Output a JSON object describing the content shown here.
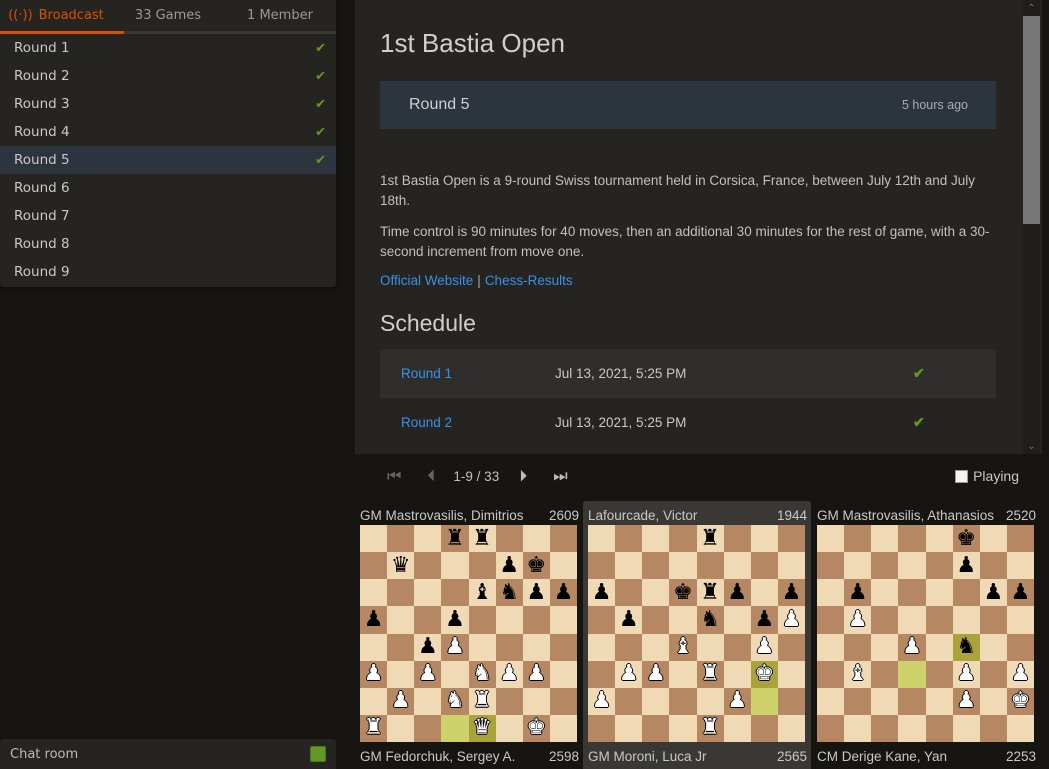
{
  "sidebar": {
    "tabs": [
      {
        "label": "Broadcast",
        "icon": "broadcast-icon",
        "active": true
      },
      {
        "label": "33 Games",
        "active": false
      },
      {
        "label": "1 Member",
        "active": false
      }
    ],
    "rounds": [
      {
        "label": "Round 1",
        "finished": true,
        "active": false
      },
      {
        "label": "Round 2",
        "finished": true,
        "active": false
      },
      {
        "label": "Round 3",
        "finished": true,
        "active": false
      },
      {
        "label": "Round 4",
        "finished": true,
        "active": false
      },
      {
        "label": "Round 5",
        "finished": true,
        "active": true
      },
      {
        "label": "Round 6",
        "finished": false,
        "active": false
      },
      {
        "label": "Round 7",
        "finished": false,
        "active": false
      },
      {
        "label": "Round 8",
        "finished": false,
        "active": false
      },
      {
        "label": "Round 9",
        "finished": false,
        "active": false
      }
    ],
    "check_glyph": "✔"
  },
  "chat": {
    "label": "Chat room",
    "enabled": true
  },
  "main": {
    "title": "1st Bastia Open",
    "current_round": {
      "name": "Round 5",
      "ago": "5 hours ago"
    },
    "description": [
      "1st Bastia Open is a 9-round Swiss tournament held in Corsica, France, between July 12th and July 18th.",
      "Time control is 90 minutes for 40 moves, then an additional 30 minutes for the rest of game, with a 30-second increment from move one."
    ],
    "links": [
      {
        "label": "Official Website"
      },
      {
        "label": "Chess-Results"
      }
    ],
    "link_separator": "|",
    "schedule_title": "Schedule",
    "schedule": [
      {
        "round": "Round 1",
        "date": "Jul 13, 2021, 5:25 PM",
        "finished": true
      },
      {
        "round": "Round 2",
        "date": "Jul 13, 2021, 5:25 PM",
        "finished": true
      }
    ]
  },
  "scrollbar": {
    "up": "⌃",
    "down": "⌄"
  },
  "pager": {
    "first": "⏮",
    "prev": "⏴",
    "info": "1-9 / 33",
    "next": "⏵",
    "last": "⏭",
    "playing_label": "Playing",
    "playing_checked": false
  },
  "games": [
    {
      "top": {
        "name": "GM Mastrovasilis, Dimitrios",
        "rating": "2609"
      },
      "bottom": {
        "name": "GM Fedorchuk, Sergey A.",
        "rating": "2598"
      },
      "highlighted": false,
      "fen": "3rr3/1q3pk1/4bnpp/p2p4/2pP4/P1P1NPP1/1P1NR3/R3Q1K1",
      "last_move": [
        "d1",
        "e1"
      ]
    },
    {
      "top": {
        "name": "Lafourcade, Victor",
        "rating": "1944"
      },
      "bottom": {
        "name": "GM Moroni, Luca Jr",
        "rating": "2565"
      },
      "highlighted": true,
      "fen": "4r3/8/p2krp1p/1p2n1pP/3B2P1/1PP1R1K1/P4P2/4R3",
      "last_move": [
        "g2",
        "g3"
      ]
    },
    {
      "top": {
        "name": "GM Mastrovasilis, Athanasios",
        "rating": "2520"
      },
      "bottom": {
        "name": "CM Derige Kane, Yan",
        "rating": "2253"
      },
      "highlighted": false,
      "fen": "5k2/5p2/1p4pp/1P6/3P1n2/1B3P1P/5P1K/8",
      "last_move": [
        "d3",
        "f4"
      ]
    }
  ],
  "piece_glyphs": {
    "k": "♚",
    "q": "♛",
    "r": "♜",
    "b": "♝",
    "n": "♞",
    "p": "♟"
  }
}
